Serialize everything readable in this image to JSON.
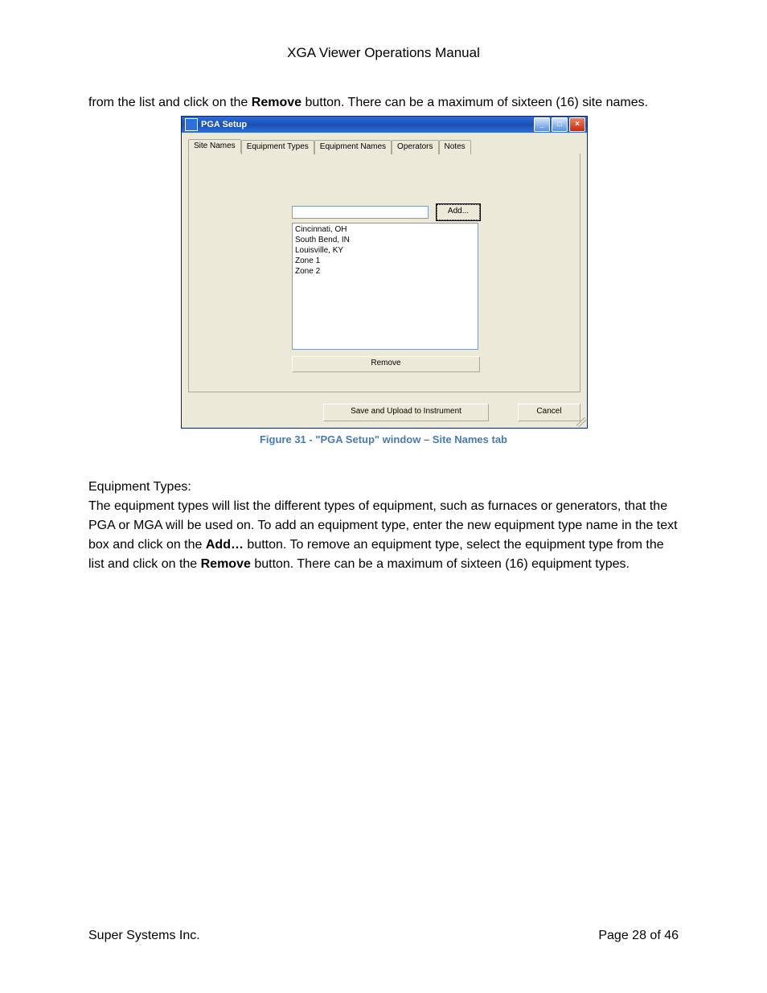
{
  "header_title": "XGA Viewer Operations Manual",
  "para1_prefix": "from the list and click on the ",
  "para1_bold": "Remove",
  "para1_suffix": " button.  There can be a maximum of sixteen (16) site names.",
  "window": {
    "title": "PGA Setup",
    "tabs": [
      "Site Names",
      "Equipment Types",
      "Equipment Names",
      "Operators",
      "Notes"
    ],
    "active_tab_index": 0,
    "add_label": "Add...",
    "list_items": [
      "Cincinnati, OH",
      "South Bend, IN",
      "Louisville, KY",
      "Zone 1",
      "Zone 2"
    ],
    "remove_label": "Remove",
    "save_label": "Save and Upload to Instrument",
    "cancel_label": "Cancel",
    "min_glyph": "_",
    "max_glyph": "□",
    "close_glyph": "×"
  },
  "figure_caption": "Figure 31 - \"PGA Setup\" window – Site Names tab",
  "section_heading": "Equipment Types:",
  "para2_part1": "The equipment types will list the different types of equipment, such as furnaces or generators, that the PGA or MGA will be used on.  To add an equipment type, enter the new equipment type name in the text box and click on the ",
  "para2_bold1": "Add…",
  "para2_part2": " button.  To remove an equipment type, select the equipment type from the list and click on the ",
  "para2_bold2": "Remove",
  "para2_part3": " button.  There can be a maximum of sixteen (16) equipment types.",
  "footer_left": "Super Systems Inc.",
  "footer_right": "Page 28 of 46"
}
